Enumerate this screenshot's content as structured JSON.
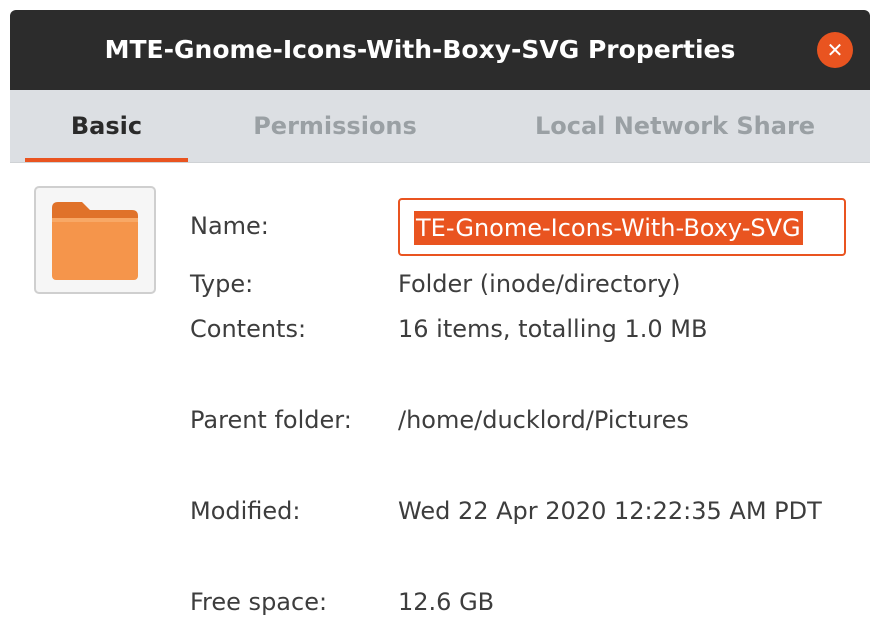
{
  "window": {
    "title": "MTE-Gnome-Icons-With-Boxy-SVG Properties",
    "close_icon": "close-icon",
    "accent_color": "#e95420"
  },
  "tabs": [
    {
      "label": "Basic",
      "active": true
    },
    {
      "label": "Permissions",
      "active": false
    },
    {
      "label": "Local Network Share",
      "active": false
    }
  ],
  "basic": {
    "folder_icon": "folder-icon",
    "name_label": "Name:",
    "name_value": "TE-Gnome-Icons-With-Boxy-SVG",
    "type_label": "Type:",
    "type_value": "Folder (inode/directory)",
    "contents_label": "Contents:",
    "contents_value": "16 items, totalling 1.0 MB",
    "parent_label": "Parent folder:",
    "parent_value": "/home/ducklord/Pictures",
    "modified_label": "Modified:",
    "modified_value": "Wed 22 Apr 2020 12:22:35 AM PDT",
    "free_label": "Free space:",
    "free_value": "12.6 GB"
  }
}
